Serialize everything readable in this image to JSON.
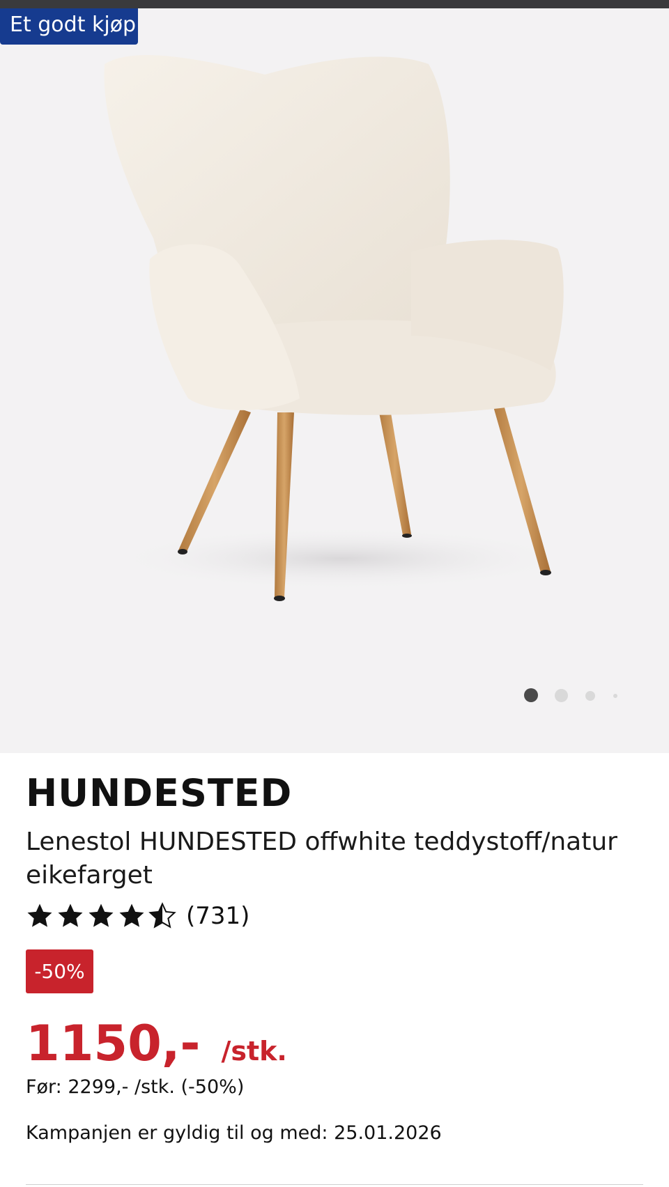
{
  "badge": {
    "label": "Et godt kjøp",
    "color": "#163b8f"
  },
  "gallery": {
    "image_icon": "armchair-photo",
    "dot_count": 4,
    "active_dot": 1
  },
  "product": {
    "name": "HUNDESTED",
    "description": "Lenestol HUNDESTED offwhite teddystoff/natur eikefarget",
    "rating": {
      "value": 4.5,
      "max": 5,
      "count_text": "(731)",
      "star_icon": "star-icon"
    },
    "discount_badge": "-50%",
    "price": {
      "amount": "1150,-",
      "unit": "/stk.",
      "color": "#c8232c"
    },
    "before_price": "Før: 2299,- /stk. (-50%)",
    "campaign_text": "Kampanjen er gyldig til og med: 25.01.2026"
  }
}
